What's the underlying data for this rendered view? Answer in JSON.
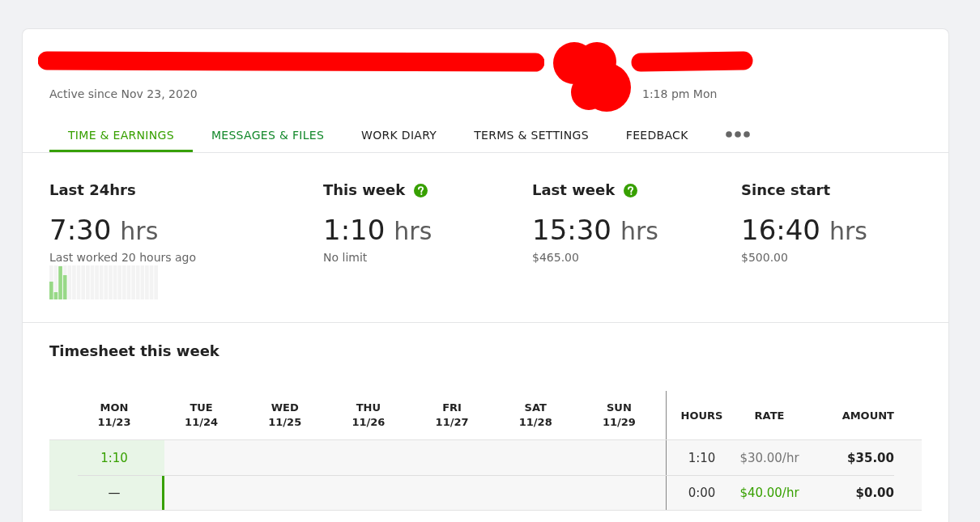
{
  "header": {
    "active_since": "Active since Nov 23, 2020",
    "local_time": "1:18 pm Mon"
  },
  "tabs": [
    {
      "label": "TIME & EARNINGS",
      "selected": true,
      "highlighted": true
    },
    {
      "label": "MESSAGES & FILES",
      "selected": false,
      "highlighted": true
    },
    {
      "label": "WORK DIARY",
      "selected": false,
      "highlighted": false
    },
    {
      "label": "TERMS & SETTINGS",
      "selected": false,
      "highlighted": false
    },
    {
      "label": "FEEDBACK",
      "selected": false,
      "highlighted": false
    }
  ],
  "stats": [
    {
      "title": "Last 24hrs",
      "help": false,
      "value": "7:30",
      "unit": "hrs",
      "note": "Last worked 20 hours ago",
      "sparkline": true
    },
    {
      "title": "This week",
      "help": true,
      "value": "1:10",
      "unit": "hrs",
      "note": "No limit",
      "sparkline": false
    },
    {
      "title": "Last week",
      "help": true,
      "value": "15:30",
      "unit": "hrs",
      "note": "$465.00",
      "sparkline": false
    },
    {
      "title": "Since start",
      "help": false,
      "value": "16:40",
      "unit": "hrs",
      "note": "$500.00",
      "sparkline": false
    }
  ],
  "timesheet": {
    "title": "Timesheet this week",
    "days": [
      {
        "day": "MON",
        "date": "11/23",
        "today": true
      },
      {
        "day": "TUE",
        "date": "11/24",
        "today": false
      },
      {
        "day": "WED",
        "date": "11/25",
        "today": false
      },
      {
        "day": "THU",
        "date": "11/26",
        "today": false
      },
      {
        "day": "FRI",
        "date": "11/27",
        "today": false
      },
      {
        "day": "SAT",
        "date": "11/28",
        "today": false
      },
      {
        "day": "SUN",
        "date": "11/29",
        "today": false
      }
    ],
    "summary_columns": [
      "HOURS",
      "RATE",
      "AMOUNT"
    ],
    "rows": [
      {
        "entries": [
          {
            "text": "1:10",
            "link": true
          }
        ],
        "hours": "1:10",
        "rate": "$30.00/hr",
        "rate_highlighted": false,
        "amount": "$35.00",
        "edge_marker": false
      },
      {
        "entries": [
          {
            "text": "—",
            "link": false
          }
        ],
        "hours": "0:00",
        "rate": "$40.00/hr",
        "rate_highlighted": true,
        "amount": "$0.00",
        "edge_marker": true
      }
    ]
  }
}
